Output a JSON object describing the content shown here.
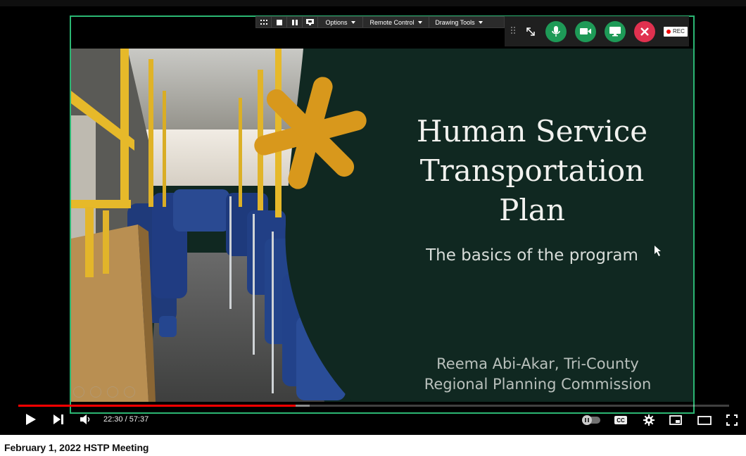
{
  "slide": {
    "title_lines": [
      "Human Service",
      "Transportation",
      "Plan"
    ],
    "subtitle": "The basics of the program",
    "author_lines": [
      "Reema Abi-Akar, Tri-County",
      "Regional Planning Commission"
    ]
  },
  "share_toolbar": {
    "items": [
      {
        "icon": "grid-icon"
      },
      {
        "icon": "stop-icon"
      },
      {
        "icon": "pause-icon"
      },
      {
        "icon": "monitor-icon"
      }
    ],
    "options_label": "Options",
    "remote_control_label": "Remote Control",
    "drawing_tools_label": "Drawing Tools"
  },
  "meeting_controls": {
    "rec_label": "REC",
    "colors": {
      "green": "#1e9a57",
      "red": "#e0314f"
    }
  },
  "player": {
    "current_time": "22:30",
    "duration": "57:37",
    "time_display": "22:30 / 57:37",
    "progress_fraction": 0.39,
    "buffer_fraction": 0.41,
    "cc_label": "CC",
    "accent_color": "#ff0000"
  },
  "video_title": "February 1, 2022 HSTP Meeting"
}
